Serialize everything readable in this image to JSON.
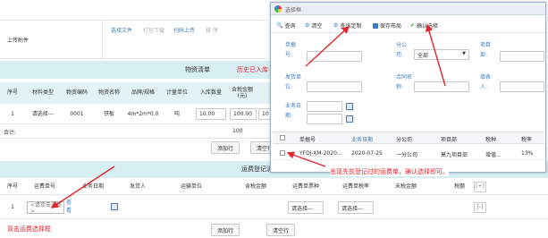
{
  "attachments": {
    "label": "上传附件",
    "actions": [
      "选择文件",
      "打包下载",
      "扫码上传",
      "排 序"
    ]
  },
  "material": {
    "title": "物资清单",
    "annotation": "历史已入库",
    "headers": [
      "序号",
      "材料类型",
      "物资编码",
      "物资名称",
      "品牌/规格",
      "计量单位",
      "入库数量",
      "含税金额(元)"
    ],
    "row": [
      "1",
      "请选择---",
      "0001",
      "铁板",
      "4m*2m*0.0",
      "吨",
      "10.00",
      "100.00",
      "10"
    ],
    "total_label": "合计:",
    "total_value": "100",
    "add_row": "添加行",
    "clear_rows": "清空行"
  },
  "freight": {
    "title": "运费登记清单",
    "headers": [
      "序号",
      "运费单号",
      "业务日期",
      "发货人",
      "运输单位",
      "含税金额",
      "运费单票种",
      "运费单税率",
      "未税金额",
      "税额",
      "[+]"
    ],
    "row_no": "1",
    "selector_placeholder": "<请双击选择>",
    "view_link": "查看",
    "ticket_select": "请选择---",
    "rate_select": "请选择---",
    "remove": "[-]",
    "add_row": "添加行",
    "clear_rows": "清空行"
  },
  "annotations": {
    "double_click": "双击运费选择框",
    "dialog_hint": "出现先前登记过的运费单，确认选择即可。"
  },
  "dialog": {
    "title": "选择框",
    "toolbar": [
      "查询",
      "清空",
      "查询定制",
      "保存布局",
      "确认选择"
    ],
    "form": {
      "bill_no_label": "单据号:",
      "company_label": "分公司:",
      "company_value": "全部",
      "project_label": "项目部:",
      "shipper_label": "发货单位:",
      "contract_label": "合同名称:",
      "filler_label": "填表人:",
      "bizdate_label": "业务日期:"
    },
    "grid": {
      "headers": [
        "单据号",
        "业务日期",
        "分公司",
        "项目部",
        "税种",
        "税率"
      ],
      "rows": [
        [
          "YFDJ-XM-2020...",
          "2020-07-25",
          "一分公司",
          "莫九项目部",
          "增值...",
          "13%"
        ]
      ]
    }
  },
  "colors": {
    "accent": "#3a7dc1",
    "annotation_red": "#e0262e",
    "header_bg": "#e2f2f5",
    "section_bg": "#d7eef3"
  }
}
